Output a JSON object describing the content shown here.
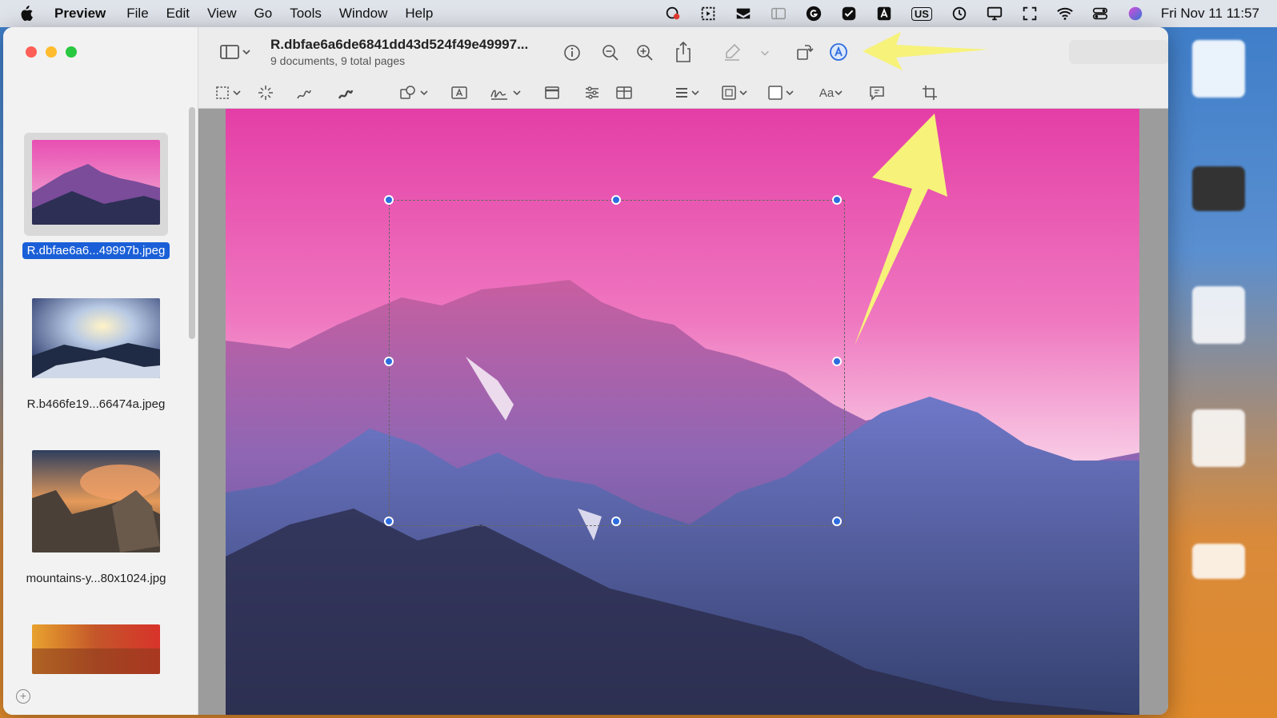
{
  "menubar": {
    "app_name": "Preview",
    "items": [
      "File",
      "Edit",
      "View",
      "Go",
      "Tools",
      "Window",
      "Help"
    ],
    "keyboard_layout": "US",
    "clock": "Fri Nov 11  11:57"
  },
  "window": {
    "title": "R.dbfae6a6de6841dd43d524f49e49997...",
    "subtitle": "9 documents, 9 total pages"
  },
  "sidebar": {
    "items": [
      {
        "label": "R.dbfae6a6...49997b.jpeg",
        "selected": true
      },
      {
        "label": "R.b466fe19...66474a.jpeg",
        "selected": false
      },
      {
        "label": "mountains-y...80x1024.jpg",
        "selected": false
      },
      {
        "label": "",
        "selected": false
      }
    ]
  },
  "colors": {
    "accent": "#1a5fd8",
    "handle": "#2d6cdf",
    "arrow": "#f7f27a"
  },
  "toolbar_icons": [
    "sidebar-toggle-icon",
    "info-icon",
    "zoom-out-icon",
    "zoom-in-icon",
    "share-icon",
    "highlight-pen-icon",
    "rotate-icon",
    "markup-icon"
  ],
  "markup_icons": [
    "rectangular-selection-icon",
    "instant-alpha-icon",
    "sketch-icon",
    "draw-icon",
    "shapes-icon",
    "text-box-icon",
    "signature-icon",
    "note-icon",
    "adjust-color-icon",
    "adjust-size-icon",
    "line-style-icon",
    "border-color-icon",
    "fill-color-icon",
    "text-style-icon",
    "description-icon",
    "crop-icon"
  ]
}
